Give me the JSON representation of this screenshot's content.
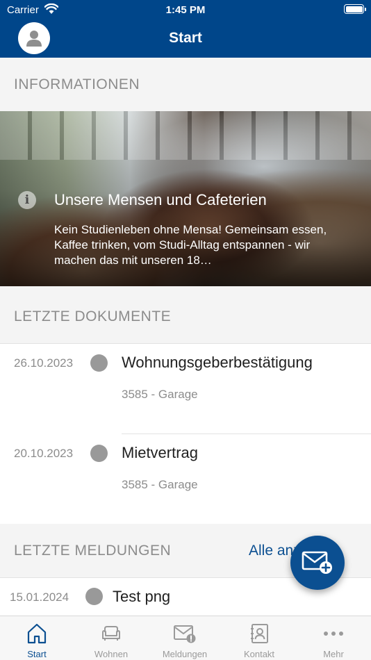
{
  "status_bar": {
    "carrier": "Carrier",
    "time": "1:45 PM"
  },
  "header": {
    "title": "Start"
  },
  "informationen": {
    "heading": "INFORMATIONEN",
    "banner": {
      "title": "Unsere Mensen und Cafeterien",
      "text": "Kein Studienleben ohne Mensa! Gemeinsam essen, Kaffee trinken, vom Studi-Alltag entspannen - wir machen das mit unseren 18…"
    }
  },
  "documents": {
    "heading": "LETZTE DOKUMENTE",
    "items": [
      {
        "date": "26.10.2023",
        "name": "Wohnungsgeberbestätigung",
        "sub": "3585 - Garage"
      },
      {
        "date": "20.10.2023",
        "name": "Mietvertrag",
        "sub": "3585 - Garage"
      }
    ]
  },
  "messages": {
    "heading": "LETZTE MELDUNGEN",
    "link": "Alle anzeigen",
    "items": [
      {
        "date": "15.01.2024",
        "name": "Test png"
      }
    ]
  },
  "tabbar": {
    "tabs": [
      {
        "label": "Start",
        "icon": "home-icon",
        "active": true
      },
      {
        "label": "Wohnen",
        "icon": "sofa-icon",
        "active": false
      },
      {
        "label": "Meldungen",
        "icon": "mail-alert-icon",
        "active": false
      },
      {
        "label": "Kontakt",
        "icon": "contact-book-icon",
        "active": false
      },
      {
        "label": "Mehr",
        "icon": "more-dots-icon",
        "active": false
      }
    ]
  },
  "colors": {
    "primary": "#00468a",
    "accent": "#0b4f91",
    "muted": "#8c8c8c"
  }
}
